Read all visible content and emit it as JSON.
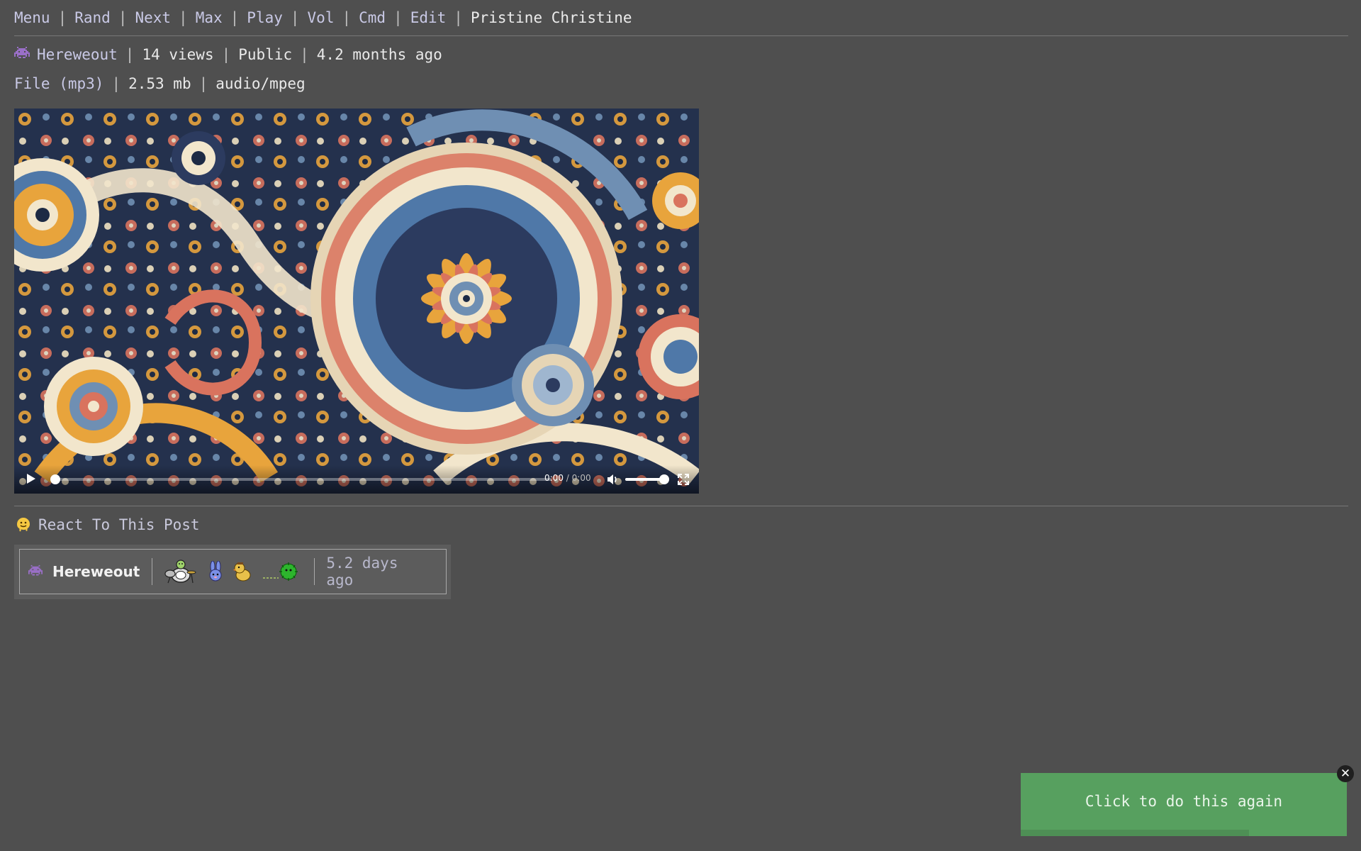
{
  "nav": {
    "items": [
      "Menu",
      "Rand",
      "Next",
      "Max",
      "Play",
      "Vol",
      "Cmd",
      "Edit"
    ],
    "title": "Pristine Christine"
  },
  "post": {
    "user_icon": "alien-monster-icon",
    "user": "Hereweout",
    "views": "14 views",
    "visibility": "Public",
    "posted": "4.2 months ago"
  },
  "file": {
    "label": "File (mp3)",
    "size": "2.53 mb",
    "mime": "audio/mpeg"
  },
  "player": {
    "current": "0:00",
    "separator": "/",
    "duration": "0:00",
    "progress": 0,
    "volume": 1.0
  },
  "react": {
    "icon": "melting-face-icon",
    "label": "React To This Post"
  },
  "reactions": [
    {
      "user": "Hereweout",
      "user_icon": "alien-monster-icon",
      "emojis": [
        "drum-kit-sticker-icon",
        "blue-bunny-sticker-icon",
        "duck-sticker-icon",
        "green-bug-sticker-icon"
      ],
      "time": "5.2 days ago"
    }
  ],
  "toast": {
    "message": "Click to do this again",
    "close_symbol": "✕",
    "progress": 0.7
  },
  "colors": {
    "background": "#4f4f4f",
    "link": "#c9c9e6",
    "toast": "#57a05f"
  }
}
